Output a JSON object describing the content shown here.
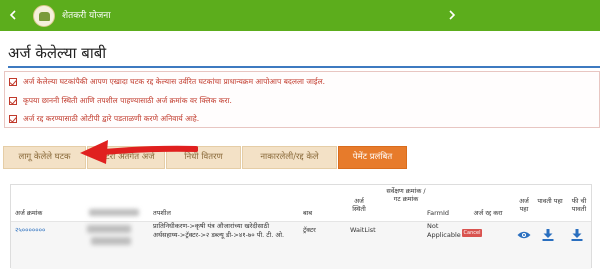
{
  "header": {
    "app_title": "शेतकरी योजना",
    "nav_left_icon": "chevron-left-icon",
    "nav_right_icon": "chevron-right-icon",
    "bar_color": "#5cad1c"
  },
  "page": {
    "title": "अर्ज केलेल्या बाबी"
  },
  "notices": [
    "अर्ज केलेल्या घटकांपैकी आपण एखादा घटक रद्द केल्यास उर्वरित घटकांचा प्राधान्यक्रम आपोआप बदलला जाईल.",
    "कृपया छाननी स्थिती आणि तपशील पाहण्यासाठी अर्ज क्रमांक वर क्लिक करा.",
    "अर्ज रद्द करण्यासाठी ओटीपी द्वारे पडताळणी करणे अनिवार्य आहे."
  ],
  "tabs": [
    {
      "label": "लागू केलेले घटक",
      "active": false
    },
    {
      "label": "लॉटरी अंतर्गत अर्ज",
      "active": false
    },
    {
      "label": "निधी वितरण",
      "active": false
    },
    {
      "label": "नाकारलेली/रद्द केले",
      "active": false
    },
    {
      "label": "पेमेंट प्रलंबित",
      "active": true
    }
  ],
  "table": {
    "columns": [
      "अर्ज क्रमांक",
      "तपशील",
      "बाब",
      "अर्ज स्थिती",
      "सर्वेक्षण क्रमांक / गट क्रमांक",
      "FarmId",
      "अर्ज रद्द करा",
      "अर्ज पहा",
      "पावती पहा",
      "फी ची पावती"
    ],
    "rows": [
      {
        "application_no": "२५०००००००",
        "details_line1": "प्रातिनिधीकरण->कृषी यंत्र औजारांच्या खरेदीसाठी",
        "details_line2": "अर्थसहाय्य->ट्रॅक्टर->२ डब्ल्यू डी->४१-७० पी. टी. ओ.",
        "item": "ट्रॅक्टर",
        "status": "WaitList",
        "survey_no": "",
        "farm_id_line1": "Not",
        "farm_id_line2": "Applicable",
        "cancel_label": "Cancel"
      }
    ]
  },
  "colors": {
    "notice_text": "#c0392b",
    "active_tab": "#e77b2b",
    "inactive_tab": "#f3e1c6",
    "title_underline": "#3e7ac0",
    "link": "#2a6fbf",
    "annotation_arrow": "#e0201f"
  }
}
